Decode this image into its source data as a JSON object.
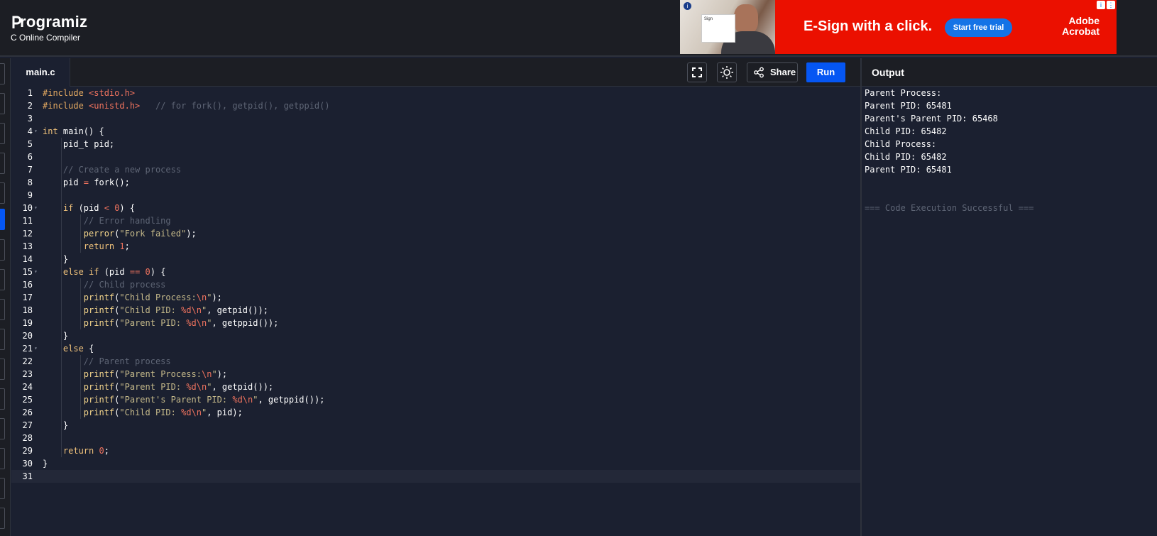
{
  "header": {
    "brand": "rogramiz",
    "subtitle": "C Online Compiler"
  },
  "ad": {
    "headline": "E-Sign with a click.",
    "cta": "Start free trial",
    "brand_line1": "Adobe",
    "brand_line2": "Acrobat",
    "card_text": "Sign"
  },
  "editor": {
    "tab": "main.c",
    "share_label": "Share",
    "run_label": "Run",
    "fold_lines": [
      4,
      10,
      15,
      21
    ]
  },
  "code_lines": [
    [
      [
        "pp",
        "#include "
      ],
      [
        "inc",
        "<stdio.h>"
      ]
    ],
    [
      [
        "pp",
        "#include "
      ],
      [
        "inc",
        "<unistd.h>"
      ],
      [
        "plain",
        "   "
      ],
      [
        "com",
        "// for fork(), getpid(), getppid()"
      ]
    ],
    [],
    [
      [
        "kw",
        "int"
      ],
      [
        "plain",
        " main() {"
      ]
    ],
    [
      [
        "plain",
        "    pid_t pid;"
      ]
    ],
    [],
    [
      [
        "plain",
        "    "
      ],
      [
        "com",
        "// Create a new process"
      ]
    ],
    [
      [
        "plain",
        "    pid "
      ],
      [
        "op",
        "="
      ],
      [
        "plain",
        " fork();"
      ]
    ],
    [],
    [
      [
        "plain",
        "    "
      ],
      [
        "kw",
        "if"
      ],
      [
        "plain",
        " (pid "
      ],
      [
        "op",
        "<"
      ],
      [
        "plain",
        " "
      ],
      [
        "num",
        "0"
      ],
      [
        "plain",
        ") {"
      ]
    ],
    [
      [
        "plain",
        "        "
      ],
      [
        "com",
        "// Error handling"
      ]
    ],
    [
      [
        "plain",
        "        "
      ],
      [
        "fn",
        "perror"
      ],
      [
        "plain",
        "("
      ],
      [
        "str",
        "\"Fork failed\""
      ],
      [
        "plain",
        ");"
      ]
    ],
    [
      [
        "plain",
        "        "
      ],
      [
        "kw",
        "return"
      ],
      [
        "plain",
        " "
      ],
      [
        "num",
        "1"
      ],
      [
        "plain",
        ";"
      ]
    ],
    [
      [
        "plain",
        "    }"
      ]
    ],
    [
      [
        "plain",
        "    "
      ],
      [
        "kw",
        "else if"
      ],
      [
        "plain",
        " (pid "
      ],
      [
        "op",
        "=="
      ],
      [
        "plain",
        " "
      ],
      [
        "num",
        "0"
      ],
      [
        "plain",
        ") {"
      ]
    ],
    [
      [
        "plain",
        "        "
      ],
      [
        "com",
        "// Child process"
      ]
    ],
    [
      [
        "plain",
        "        "
      ],
      [
        "fn",
        "printf"
      ],
      [
        "plain",
        "("
      ],
      [
        "str",
        "\"Child Process:"
      ],
      [
        "esc",
        "\\n"
      ],
      [
        "str",
        "\""
      ],
      [
        "plain",
        ");"
      ]
    ],
    [
      [
        "plain",
        "        "
      ],
      [
        "fn",
        "printf"
      ],
      [
        "plain",
        "("
      ],
      [
        "str",
        "\"Child PID: "
      ],
      [
        "esc",
        "%d\\n"
      ],
      [
        "str",
        "\""
      ],
      [
        "plain",
        ", getpid());"
      ]
    ],
    [
      [
        "plain",
        "        "
      ],
      [
        "fn",
        "printf"
      ],
      [
        "plain",
        "("
      ],
      [
        "str",
        "\"Parent PID: "
      ],
      [
        "esc",
        "%d\\n"
      ],
      [
        "str",
        "\""
      ],
      [
        "plain",
        ", getppid());"
      ]
    ],
    [
      [
        "plain",
        "    }"
      ]
    ],
    [
      [
        "plain",
        "    "
      ],
      [
        "kw",
        "else"
      ],
      [
        "plain",
        " {"
      ]
    ],
    [
      [
        "plain",
        "        "
      ],
      [
        "com",
        "// Parent process"
      ]
    ],
    [
      [
        "plain",
        "        "
      ],
      [
        "fn",
        "printf"
      ],
      [
        "plain",
        "("
      ],
      [
        "str",
        "\"Parent Process:"
      ],
      [
        "esc",
        "\\n"
      ],
      [
        "str",
        "\""
      ],
      [
        "plain",
        ");"
      ]
    ],
    [
      [
        "plain",
        "        "
      ],
      [
        "fn",
        "printf"
      ],
      [
        "plain",
        "("
      ],
      [
        "str",
        "\"Parent PID: "
      ],
      [
        "esc",
        "%d\\n"
      ],
      [
        "str",
        "\""
      ],
      [
        "plain",
        ", getpid());"
      ]
    ],
    [
      [
        "plain",
        "        "
      ],
      [
        "fn",
        "printf"
      ],
      [
        "plain",
        "("
      ],
      [
        "str",
        "\"Parent's Parent PID: "
      ],
      [
        "esc",
        "%d\\n"
      ],
      [
        "str",
        "\""
      ],
      [
        "plain",
        ", getppid());"
      ]
    ],
    [
      [
        "plain",
        "        "
      ],
      [
        "fn",
        "printf"
      ],
      [
        "plain",
        "("
      ],
      [
        "str",
        "\"Child PID: "
      ],
      [
        "esc",
        "%d\\n"
      ],
      [
        "str",
        "\""
      ],
      [
        "plain",
        ", pid);"
      ]
    ],
    [
      [
        "plain",
        "    }"
      ]
    ],
    [],
    [
      [
        "plain",
        "    "
      ],
      [
        "kw",
        "return"
      ],
      [
        "plain",
        " "
      ],
      [
        "num",
        "0"
      ],
      [
        "plain",
        ";"
      ]
    ],
    [
      [
        "plain",
        "}"
      ]
    ],
    []
  ],
  "output": {
    "title": "Output",
    "lines": [
      "Parent Process:",
      "Parent PID: 65481",
      "Parent's Parent PID: 65468",
      "Child PID: 65482",
      "Child Process:",
      "Child PID: 65482",
      "Parent PID: 65481"
    ],
    "status": "=== Code Execution Successful ==="
  }
}
